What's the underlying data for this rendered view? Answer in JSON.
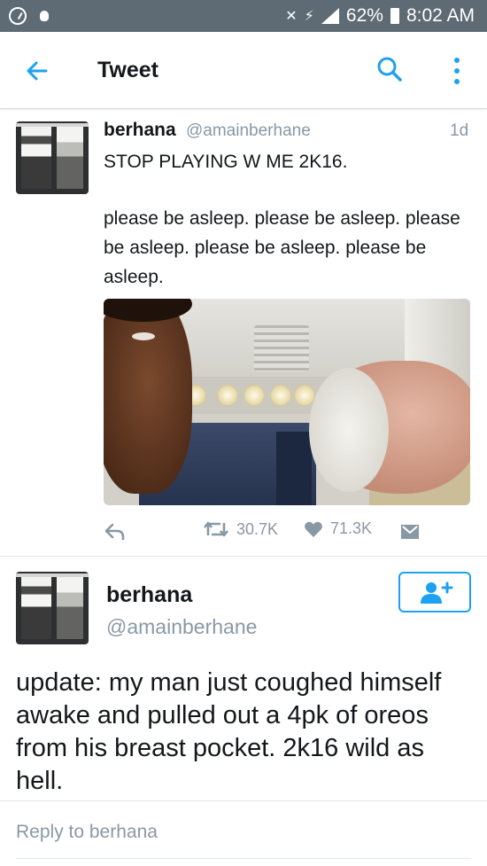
{
  "status_bar": {
    "battery": "62%",
    "time": "8:02 AM"
  },
  "header": {
    "title": "Tweet",
    "accent_color": "#1da1f2"
  },
  "tweet": {
    "name": "berhana",
    "handle": "@amainberhane",
    "time": "1d",
    "headline": "STOP PLAYING W ME 2K16.",
    "body": "please be asleep. please be asleep. please be asleep. please be asleep. please be asleep.",
    "retweets": "30.7K",
    "likes": "71.3K"
  },
  "reply_tweet": {
    "name": "berhana",
    "handle": "@amainberhane",
    "body": "update: my man just coughed himself awake and pulled out a 4pk of oreos from his breast pocket. 2k16 wild as hell."
  },
  "reply_bar": {
    "placeholder": "Reply to berhana"
  },
  "icons": {
    "back": "arrow-left-icon",
    "search": "search-icon",
    "more": "more-vertical-icon",
    "reply": "reply-icon",
    "retweet": "retweet-icon",
    "like": "heart-icon",
    "dm": "direct-message-icon",
    "follow": "add-user-icon"
  }
}
